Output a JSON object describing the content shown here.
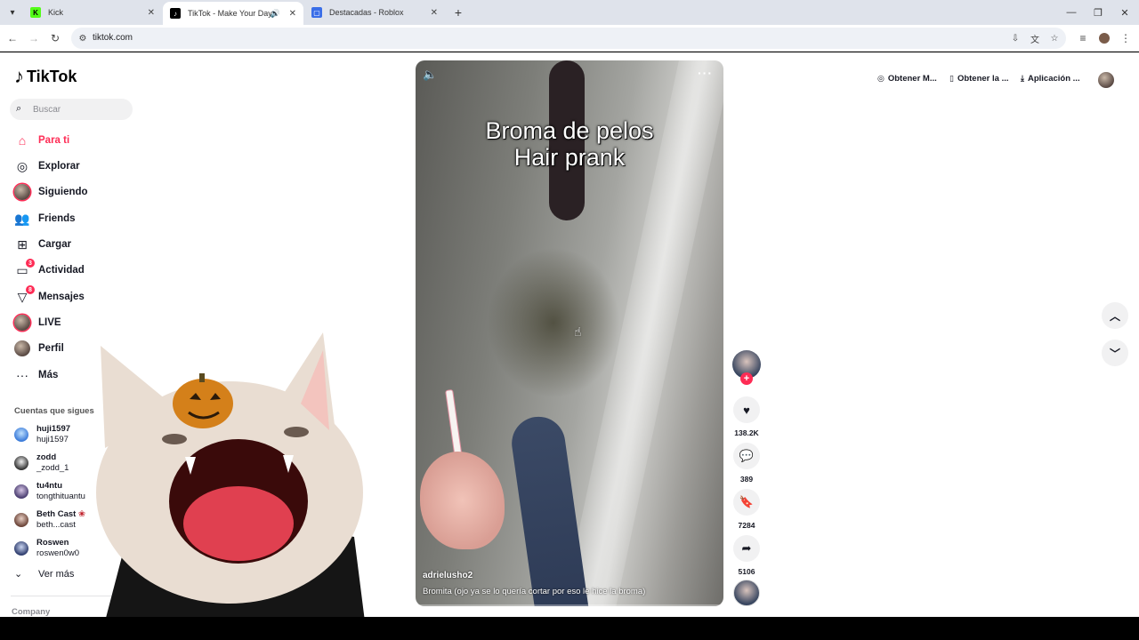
{
  "browser": {
    "tabs": [
      {
        "title": "Kick",
        "favicon_color": "#53fc18",
        "favicon_letter": "K"
      },
      {
        "title": "TikTok - Make Your Day",
        "favicon_color": "#000000",
        "favicon_letter": "♪",
        "active": true
      },
      {
        "title": "Destacadas - Roblox",
        "favicon_color": "#3a6ee8",
        "favicon_letter": "▢"
      }
    ],
    "url": "tiktok.com"
  },
  "app": {
    "logo_text": "TikTok",
    "search_placeholder": "Buscar",
    "accent_color": "#fe2c55"
  },
  "sidebar": {
    "nav": [
      {
        "label": "Para ti",
        "icon": "home-icon"
      },
      {
        "label": "Explorar",
        "icon": "compass-icon"
      },
      {
        "label": "Siguiendo",
        "icon": "following-avatar-icon"
      },
      {
        "label": "Friends",
        "icon": "friends-icon"
      },
      {
        "label": "Cargar",
        "icon": "upload-icon"
      },
      {
        "label": "Actividad",
        "icon": "activity-icon",
        "badge": "3"
      },
      {
        "label": "Mensajes",
        "icon": "messages-icon",
        "badge": "8"
      },
      {
        "label": "LIVE",
        "icon": "live-avatar-icon"
      },
      {
        "label": "Perfil",
        "icon": "profile-avatar-icon"
      },
      {
        "label": "Más",
        "icon": "more-icon"
      }
    ],
    "following_title": "Cuentas que sigues",
    "following": [
      {
        "name": "huji1597",
        "handle": "huji1597"
      },
      {
        "name": "zodd",
        "handle": "_zodd_1"
      },
      {
        "name": "tu4ntu",
        "handle": "tongthituantu"
      },
      {
        "name": "Beth Cast",
        "handle": "beth...cast"
      },
      {
        "name": "Roswen",
        "handle": "roswen0w0"
      }
    ],
    "see_more": "Ver más",
    "footer": "Company"
  },
  "header": {
    "links": [
      {
        "label": "Obtener M...",
        "icon": "coin-icon"
      },
      {
        "label": "Obtener la ...",
        "icon": "phone-icon"
      },
      {
        "label": "Aplicación ...",
        "icon": "download-icon"
      }
    ]
  },
  "video": {
    "caption_line1": "Broma de pelos",
    "caption_line2": "Hair prank",
    "author": "adrielusho2",
    "description": "Bromita (ojo ya se lo quería cortar por eso le hice la broma)"
  },
  "actions": {
    "likes": "138.2K",
    "comments": "389",
    "saves": "7284",
    "shares": "5106"
  }
}
